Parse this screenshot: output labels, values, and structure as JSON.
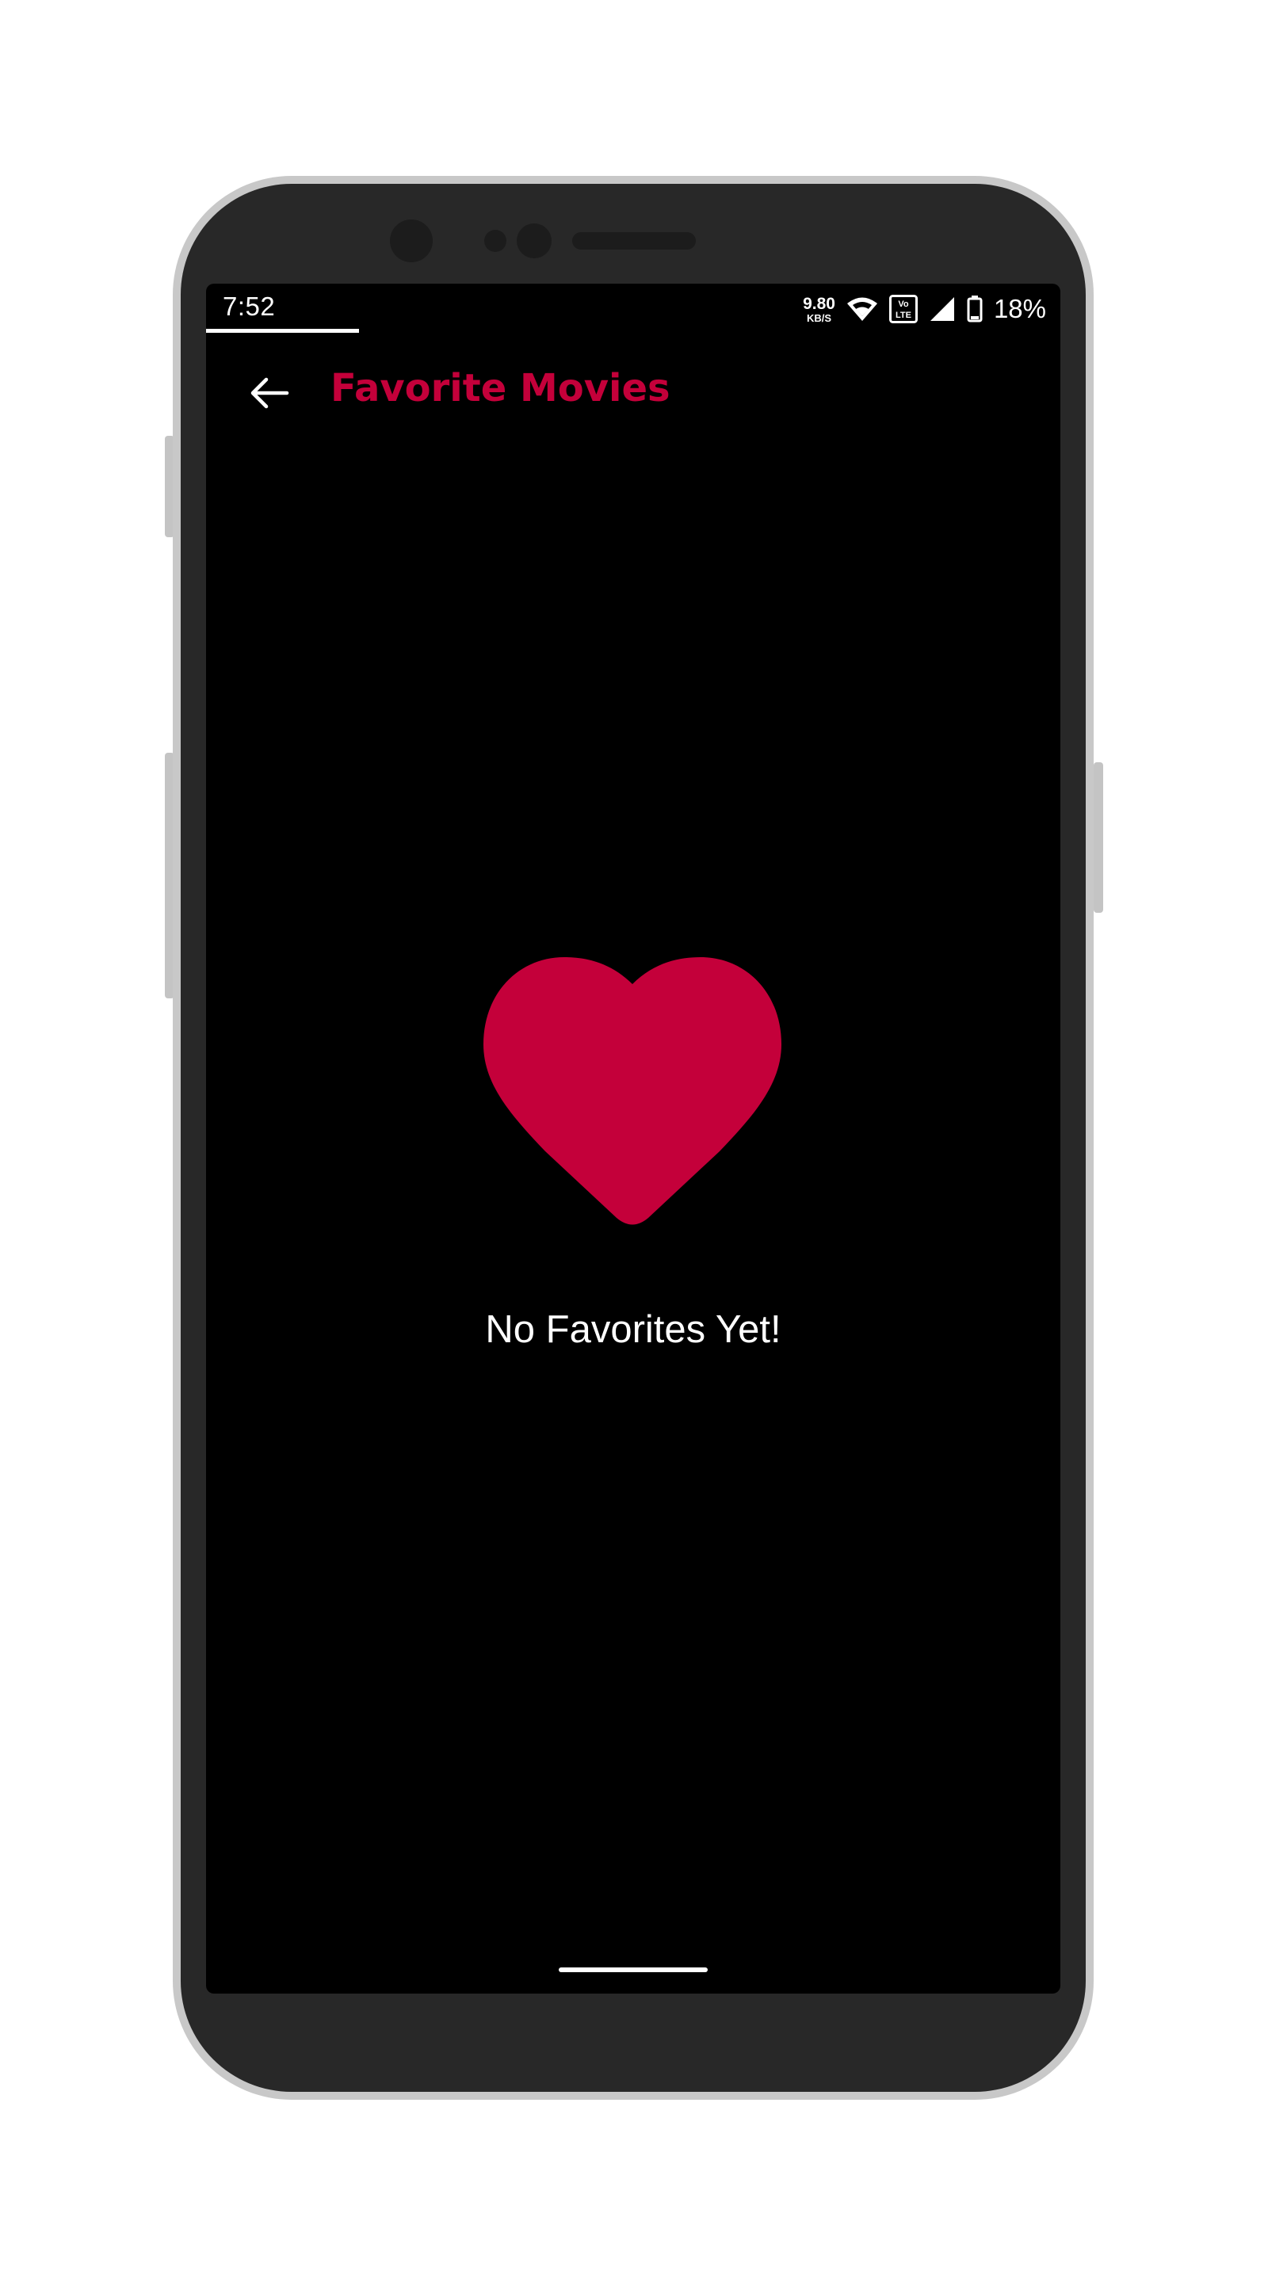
{
  "status_bar": {
    "time": "7:52",
    "net_speed_value": "9.80",
    "net_speed_unit": "KB/S",
    "volte_label_top": "Vo",
    "volte_label_bottom": "LTE",
    "battery_percent": "18%",
    "battery_level": 0.18
  },
  "app_bar": {
    "title": "Favorite Movies",
    "back_icon": "arrow-left-icon"
  },
  "empty_state": {
    "icon": "heart-icon",
    "message": "No Favorites Yet!"
  },
  "colors": {
    "accent": "#c4003a",
    "screen_background": "#000000",
    "text": "#ffffff",
    "device_body": "#282828",
    "device_frame": "#c8c8c8"
  }
}
